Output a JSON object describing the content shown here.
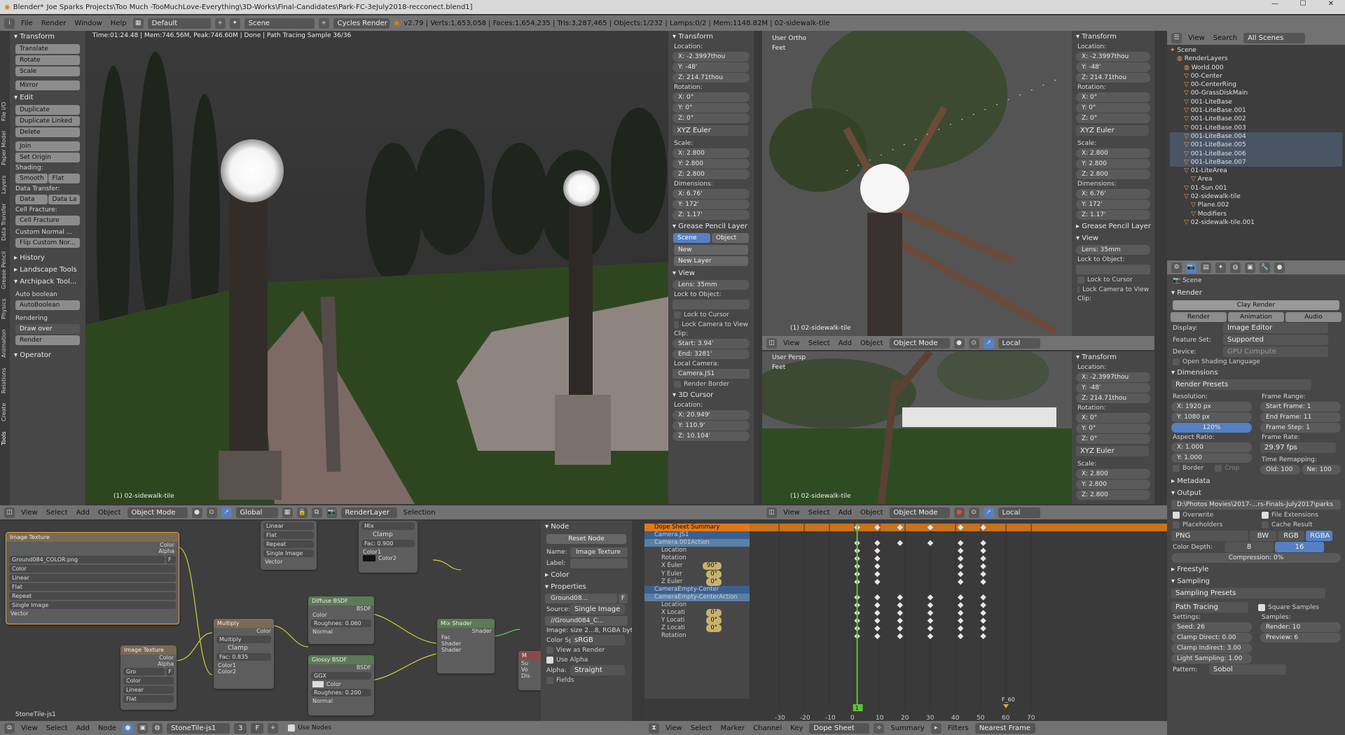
{
  "title_bar": {
    "app": "Blender*",
    "path": "Joe Sparks Projects\\Too Much -TooMuchLove-Everything\\3D-Works\\Final-Candidates\\Park-FC-3eJuly2018-recconect.blend1]"
  },
  "info_header": {
    "menus": [
      "File",
      "Render",
      "Window",
      "Help"
    ],
    "layout": "Default",
    "scene": "Scene",
    "engine": "Cycles Render",
    "stats": "v2.79 | Verts:1,653,058 | Faces:1,654,235 | Tris:3,287,465 | Objects:1/232 | Lamps:0/2 | Mem:1148.82M | 02-sidewalk-tile"
  },
  "tool_tabs": [
    "Tools",
    "Create",
    "Relations",
    "Animation",
    "Physics",
    "Grease Pencil",
    "Data Transfer",
    "Layers",
    "Paper Model",
    "File I/O"
  ],
  "tool_shelf": {
    "transform_header": "Transform",
    "transform": [
      "Translate",
      "Rotate",
      "Scale",
      "Mirror"
    ],
    "edit_header": "Edit",
    "edit": [
      "Duplicate",
      "Duplicate Linked",
      "Delete",
      "Join",
      "Set Origin"
    ],
    "shading_label": "Shading:",
    "shading": [
      "Smooth",
      "Flat"
    ],
    "data_transfer_label": "Data Transfer:",
    "data_transfer": [
      "Data",
      "Data La"
    ],
    "cell_fracture_label": "Cell Fracture:",
    "cell_fracture": "Cell Fracture",
    "custom_normal": "Custom Normal ...",
    "flip_custom": "Flip Custom Nor...",
    "history": "History",
    "landscape": "Landscape Tools",
    "archipack": "Archipack Tool...",
    "auto_boolean_label": "Auto boolean",
    "auto_boolean": "AutoBoolean",
    "rendering_label": "Rendering",
    "draw_over": "Draw over",
    "render": "Render",
    "operator": "Operator"
  },
  "viewport_main": {
    "status": "Time:01:24.48 | Mem:746.56M, Peak:746.60M | Done | Path Tracing Sample 36/36",
    "object": "(1) 02-sidewalk-tile"
  },
  "npanel_main": {
    "transform": "Transform",
    "location": "Location:",
    "loc": [
      "X: -2.3997thou",
      "Y: -48'",
      "Z: 214.71thou"
    ],
    "rotation": "Rotation:",
    "rot": [
      "X: 0°",
      "Y: 0°",
      "Z: 0°"
    ],
    "euler": "XYZ Euler",
    "scale": "Scale:",
    "scl": [
      "X: 2.800",
      "Y: 2.800",
      "Z: 2.800"
    ],
    "dimensions": "Dimensions:",
    "dim": [
      "X: 6.76'",
      "Y: 172'",
      "Z: 1.17'"
    ],
    "grease": "Grease Pencil Layer",
    "scene_tab": "Scene",
    "object_tab": "Object",
    "new": "New",
    "new_layer": "New Layer",
    "view": "View",
    "lens": "Lens: 35mm",
    "lock_to_object": "Lock to Object:",
    "lock_cursor": "Lock to Cursor",
    "lock_camera": "Lock Camera to View",
    "clip": "Clip:",
    "clip_start": "Start: 3.94'",
    "clip_end": "End: 3281'",
    "local_camera": "Local Camera:",
    "camera": "Camera.JS1",
    "render_border": "Render Border",
    "cursor": "3D Cursor",
    "cursor_loc": "Location:",
    "cur": [
      "X: 20.949'",
      "Y: 110.9'",
      "Z: 10.104'"
    ]
  },
  "viewport_top": {
    "label": "User Ortho",
    "unit": "Feet",
    "object": "(1) 02-sidewalk-tile"
  },
  "viewport_bottom": {
    "label": "User Persp",
    "unit": "Feet",
    "object": "(1) 02-sidewalk-tile"
  },
  "view_header": {
    "menus": [
      "View",
      "Select",
      "Add",
      "Object"
    ],
    "mode": "Object Mode",
    "orient": "Local",
    "orient_main": "Global",
    "layer": "RenderLayer",
    "selection": "Selection"
  },
  "npanel_right": {
    "transform": "Transform",
    "location": "Location:",
    "loc": [
      "X: -2.3997thou",
      "Y: -48'",
      "Z: 214.71thou"
    ],
    "rotation": "Rotation:",
    "rot": [
      "X: 0°",
      "Y: 0°",
      "Z: 0°"
    ],
    "euler": "XYZ Euler",
    "scale": "Scale:",
    "scl": [
      "X: 2.800",
      "Y: 2.800",
      "Z: 2.800"
    ],
    "dimensions": "Dimensions:",
    "dim": [
      "X: 6.76'",
      "Y: 172'",
      "Z: 1.17'"
    ],
    "grease": "Grease Pencil Layer",
    "view": "View",
    "lens": "Lens: 35mm",
    "lock_to_object": "Lock to Object:",
    "lock_cursor": "Lock to Cursor",
    "lock_camera": "Lock Camera to View",
    "clip": "Clip:"
  },
  "npanel_right_b": {
    "transform": "Transform",
    "location": "Location:",
    "loc": [
      "X: -2.3997thou",
      "Y: -48'",
      "Z: 214.71thou"
    ],
    "rotation": "Rotation:",
    "rot": [
      "X: 0°",
      "Y: 0°",
      "Z: 0°"
    ],
    "euler": "XYZ Euler",
    "scale": "Scale:",
    "scl": [
      "X: 2.800",
      "Y: 2.800",
      "Z: 2.800"
    ]
  },
  "outliner": {
    "menus": [
      "View",
      "Search"
    ],
    "scenes": "All Scenes",
    "items": [
      "Scene",
      "RenderLayers",
      "World.000",
      "00-Center",
      "00-CenterRing",
      "00-GrassDiskMain",
      "001-LiteBase",
      "001-LiteBase.001",
      "001-LiteBase.002",
      "001-LiteBase.003",
      "001-LiteBase.004",
      "001-LiteBase.005",
      "001-LiteBase.006",
      "001-LiteBase.007",
      "01-LiteArea",
      "Area",
      "01-Sun.001",
      "02-sidewalk-tile",
      "Plane.002",
      "Modifiers",
      "02-sidewalk-tile.001"
    ]
  },
  "properties": {
    "scene": "Scene",
    "render": "Render",
    "clay_render": "Clay Render",
    "render_btn": "Render",
    "animation_btn": "Animation",
    "audio_btn": "Audio",
    "display_label": "Display:",
    "display": "Image Editor",
    "feature_label": "Feature Set:",
    "feature": "Supported",
    "device_label": "Device:",
    "device": "GPU Compute",
    "osl": "Open Shading Language",
    "dimensions": "Dimensions",
    "presets": "Render Presets",
    "resolution": "Resolution:",
    "res_x": "X: 1920 px",
    "res_y": "Y: 1080 px",
    "res_pct": "120%",
    "frame_range": "Frame Range:",
    "start": "Start Frame: 1",
    "end": "End Frame: 11",
    "step": "Frame Step: 1",
    "aspect": "Aspect Ratio:",
    "asp_x": "X: 1.000",
    "asp_y": "Y: 1.000",
    "frame_rate": "Frame Rate:",
    "fps": "29.97 fps",
    "remap": "Time Remapping:",
    "old": "Old: 100",
    "new": "Ne: 100",
    "border": "Border",
    "crop": "Crop",
    "metadata": "Metadata",
    "output": "Output",
    "path": "D:\\Photos Movies\\2017-...rs-Finals-July2017\\parks",
    "overwrite": "Overwrite",
    "file_ext": "File Extensions",
    "placeholders": "Placeholders",
    "cache": "Cache Result",
    "format": "PNG",
    "bw": "BW",
    "rgb": "RGB",
    "rgba": "RGBA",
    "color_depth": "Color Depth:",
    "d8": "8",
    "d16": "16",
    "compression": "Compression: 0%",
    "freestyle": "Freestyle",
    "sampling": "Sampling",
    "sampling_presets": "Sampling Presets",
    "path_tracing": "Path Tracing",
    "square": "Square Samples",
    "settings": "Settings:",
    "samples": "Samples:",
    "seed": "Seed: 26",
    "render_s": "Render: 10",
    "clamp_direct": "Clamp Direct: 0.00",
    "preview": "Preview: 6",
    "clamp_indirect": "Clamp Indirect: 3.00",
    "light_sampling": "Light Sampling: 1.00",
    "pattern": "Pattern:",
    "sobol": "Sobol"
  },
  "node_editor": {
    "nodes": {
      "tex1": {
        "title": "Image Texture",
        "out": [
          "Color",
          "Alpha"
        ],
        "file": "Ground084_COLOR.png",
        "f": "F",
        "fields": [
          "Color",
          "Linear",
          "Flat",
          "Repeat",
          "Single Image"
        ],
        "vec": "Vector"
      },
      "tex2": {
        "title": "Image Texture",
        "out": [
          "Color",
          "Alpha"
        ],
        "file": "Gro",
        "f": "F",
        "fields": [
          "Color",
          "Linear",
          "Flat"
        ]
      },
      "mapping": {
        "fields": [
          "Linear",
          "Flat",
          "Repeat",
          "Single Image"
        ],
        "vec": "Vector"
      },
      "mix": {
        "mode": "Mix",
        "clamp": "Clamp",
        "fac": "Fac: 0.900",
        "c1": "Color1",
        "c2": "Color2"
      },
      "multiply": {
        "title": "Multiply",
        "out": "Color",
        "mode": "Multiply",
        "clamp": "Clamp",
        "fac": "Fac: 0.835",
        "c1": "Color1",
        "c2": "Color2"
      },
      "diffuse": {
        "title": "Diffuse BSDF",
        "out": "BSDF",
        "color": "Color",
        "rough": "Roughnes: 0.060",
        "normal": "Normal"
      },
      "glossy": {
        "title": "Glossy BSDF",
        "out": "BSDF",
        "dist": "GGX",
        "color": "Color",
        "rough": "Roughnes: 0.200",
        "normal": "Normal"
      },
      "mixshader": {
        "title": "Mix Shader",
        "out": "Shader",
        "fac": "Fac",
        "s1": "Shader",
        "s2": "Shader"
      },
      "output": {
        "title": "M",
        "rows": [
          "Su",
          "Vo",
          "Dis"
        ]
      }
    },
    "material": "StoneTile-js1"
  },
  "node_props": {
    "node": "Node",
    "reset": "Reset Node",
    "name_label": "Name:",
    "name": "Image Texture",
    "label_label": "Label:",
    "color": "Color",
    "properties": "Properties",
    "image": "Ground08...",
    "f": "F",
    "source_label": "Source:",
    "source": "Single Image",
    "file": "//Ground084_C...",
    "info": "Image: size 2...8, RGBA byte",
    "colorsp_label": "Color Sp",
    "colorsp": "sRGB",
    "view_render": "View as Render",
    "use_alpha": "Use Alpha",
    "alpha_label": "Alpha:",
    "alpha": "Straight",
    "fields": "Fields"
  },
  "node_footer": {
    "menus": [
      "View",
      "Select",
      "Add",
      "Node"
    ],
    "material": "StoneTile-js1",
    "users": "3",
    "f": "F",
    "use_nodes": "Use Nodes"
  },
  "dopesheet": {
    "rows": [
      "Dope Sheet Summary",
      "Camera.JS1",
      "Camera.001Action",
      "Location",
      "Rotation",
      "X Euler",
      "Y Euler",
      "Z Euler",
      "CameraEmpty-Center",
      "CameraEmpty-CenterAction",
      "Location",
      "X Locati",
      "Y Locati",
      "Z Locati",
      "Rotation"
    ],
    "vals": [
      "90°",
      "0°",
      "0°",
      "0°",
      "0°",
      "0°"
    ],
    "ticks": [
      "-30",
      "-20",
      "-10",
      "0",
      "10",
      "20",
      "30",
      "40",
      "50",
      "60",
      "70"
    ],
    "frame": "1",
    "marker": "F_60"
  },
  "ds_footer": {
    "menus": [
      "View",
      "Select",
      "Marker",
      "Channel",
      "Key"
    ],
    "mode": "Dope Sheet",
    "summary": "Summary",
    "filters": "Filters",
    "snap": "Nearest Frame"
  }
}
